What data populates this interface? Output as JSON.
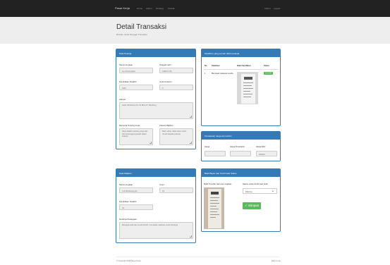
{
  "nav": {
    "brand": "Pasar Kerja",
    "links": [
      "Home",
      "Admin",
      "Tentang",
      "Kontak"
    ],
    "right_links": [
      "Admin",
      "Logout"
    ]
  },
  "header": {
    "title": "Detail Transaksi",
    "subtitle": "Rincian untuk Pengaju Transaksi"
  },
  "pekerja": {
    "heading": "Data Pekerja",
    "nama_label": "Nama Lengkap :",
    "nama_value": "Ayu Pamungkas",
    "tgl_label": "Tanggal Lahir :",
    "tgl_value": "1998-07-06",
    "pendidikan_label": "Pendidikan Terakhir :",
    "pendidikan_value": "SMA",
    "jk_label": "Jenis Kelamin :",
    "jk_value": "P",
    "alamat_label": "Alamat :",
    "alamat_value": "Jalan Cibolerang No 10 Blok A/7 Bandung",
    "cerita_label": "Bercerita Tentang Anda :",
    "cerita_value": "Saya adalah seorang yang rajin dan bertanggung jawab dalam bekerja",
    "kriteria_label": "Kriteria Majikan :",
    "kriteria_value": "Baik, sabar, tidak suka marah, ramah kepada pekerja"
  },
  "pelatihan": {
    "heading": "Pelatihan yang pernah diikuti pekerja",
    "cols": [
      "No",
      "Pelatihan",
      "Bukti Sertifikasi",
      "Status"
    ],
    "row": {
      "no": "1",
      "nama": "Memasak makanan sunda",
      "status": "accepted"
    }
  },
  "harga": {
    "heading": "Penawaran harga dari admin",
    "cols": [
      "Harga",
      "Harga Penawaran",
      "Harga Akhir"
    ],
    "values": [
      "",
      "",
      "900000"
    ]
  },
  "majikan": {
    "heading": "Data Majikan",
    "nama_label": "Nama Lengkap :",
    "nama_value": "Yudi Budimansyah",
    "umur_label": "Umur :",
    "umur_value": "43",
    "pendidikan_label": "Pendidikan Terakhir :",
    "pendidikan_value": "S1",
    "deskripsi_label": "Deskripsi Pekerjaan :",
    "deskripsi_value": "Menjaga anak dan rumah bersih, memasak makanan untuk keluarga"
  },
  "bayar": {
    "heading": "Bukti Bayar dan Konfirmasi Status",
    "bukti_label": "Bukti Transfer dari user majikan",
    "status_label": "Status untuk konfirmasi bukti",
    "status_value": "Diterima",
    "save_label": "Simpan"
  },
  "footer": {
    "left": "© Copyright 2018 Pasar Kerja",
    "right": "Back to top"
  }
}
